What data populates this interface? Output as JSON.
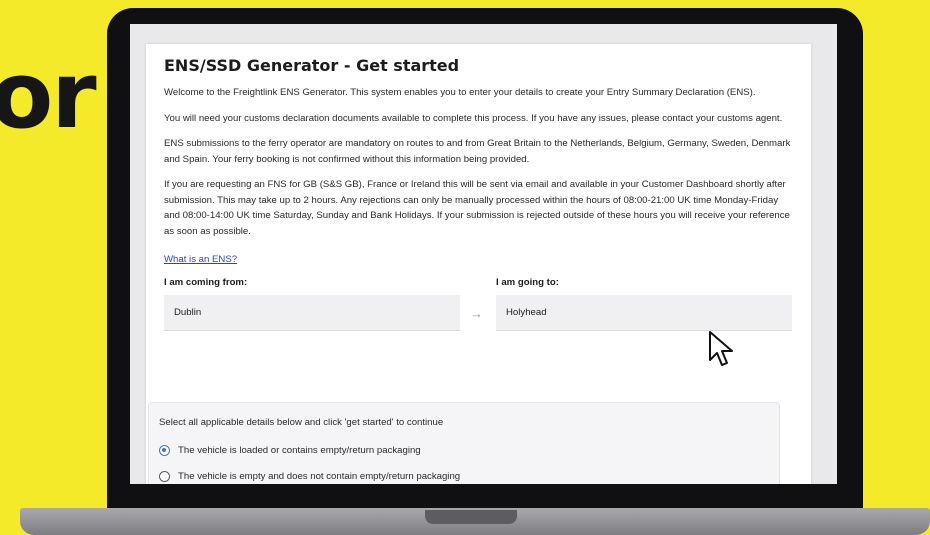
{
  "background": {
    "word": "or",
    "color": "#f4ea2a"
  },
  "page": {
    "title": "ENS/SSD Generator - Get started",
    "paragraphs": [
      "Welcome to the Freightlink ENS Generator. This system enables you to enter your details to create your Entry Summary Declaration (ENS).",
      "You will need your customs declaration documents available to complete this process. If you have any issues, please contact your customs agent.",
      "ENS submissions to the ferry operator are mandatory on routes to and from Great Britain to the Netherlands, Belgium, Germany, Sweden, Denmark and Spain. Your ferry booking is not confirmed without this information being provided.",
      "If you are requesting an FNS for GB (S&S GB), France or Ireland this will be sent via email and available in your Customer Dashboard shortly after submission. This may take up to 2 hours. Any rejections can only be manually processed within the hours of 08:00-21:00 UK time Monday-Friday and 08:00-14:00 UK time Saturday, Sunday and Bank Holidays. If your submission is rejected outside of these hours you will receive your reference as soon as possible."
    ],
    "help_link": "What is an ENS?"
  },
  "route": {
    "from_label": "I am coming from:",
    "from_value": "Dublin",
    "to_label": "I am going to:",
    "to_value": "Holyhead"
  },
  "options": {
    "instruction": "Select all applicable details below and click 'get started' to continue",
    "items": [
      {
        "label": "The vehicle is loaded or contains empty/return packaging",
        "checked": true
      },
      {
        "label": "The vehicle is empty and does not contain empty/return packaging",
        "checked": false
      }
    ]
  },
  "colors": {
    "accent": "#3478d4",
    "link": "#2646c8",
    "frame": "#101012"
  }
}
